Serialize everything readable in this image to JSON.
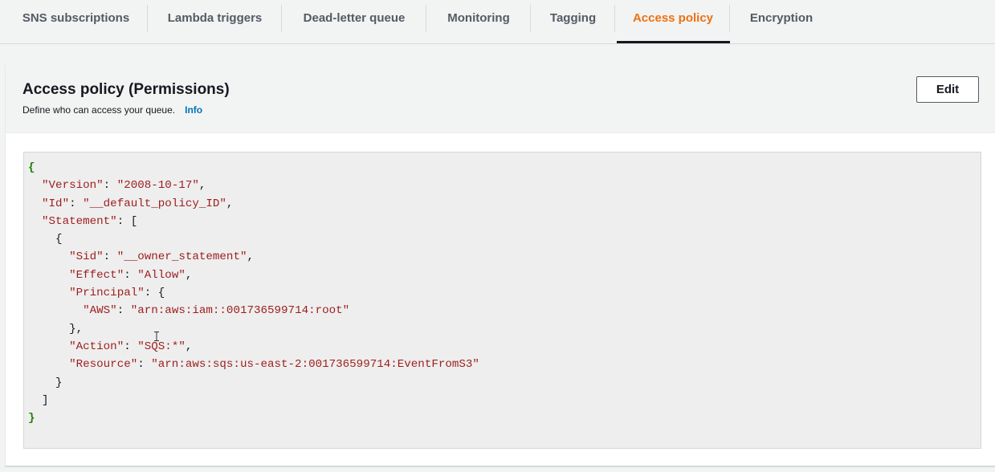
{
  "tabs": [
    {
      "label": "SNS subscriptions",
      "active": false
    },
    {
      "label": "Lambda triggers",
      "active": false
    },
    {
      "label": "Dead-letter queue",
      "active": false
    },
    {
      "label": "Monitoring",
      "active": false
    },
    {
      "label": "Tagging",
      "active": false
    },
    {
      "label": "Access policy",
      "active": true
    },
    {
      "label": "Encryption",
      "active": false
    }
  ],
  "panel": {
    "title": "Access policy (Permissions)",
    "description": "Define who can access your queue.",
    "info_label": "Info",
    "edit_label": "Edit"
  },
  "policy": {
    "open_brace": "{",
    "close_brace": "}",
    "version_key": "\"Version\"",
    "version_value": "\"2008-10-17\"",
    "id_key": "\"Id\"",
    "id_value": "\"__default_policy_ID\"",
    "statement_key": "\"Statement\"",
    "sid_key": "\"Sid\"",
    "sid_value": "\"__owner_statement\"",
    "effect_key": "\"Effect\"",
    "effect_value": "\"Allow\"",
    "principal_key": "\"Principal\"",
    "aws_key": "\"AWS\"",
    "aws_value": "\"arn:aws:iam::001736599714:root\"",
    "action_key": "\"Action\"",
    "action_value": "\"SQS:*\"",
    "resource_key": "\"Resource\"",
    "resource_value": "\"arn:aws:sqs:us-east-2:001736599714:EventFromS3\""
  },
  "colors": {
    "active_tab": "#ec7211",
    "link": "#0073bb",
    "json_string": "#9e1d1d",
    "json_brace": "#1d8102"
  }
}
